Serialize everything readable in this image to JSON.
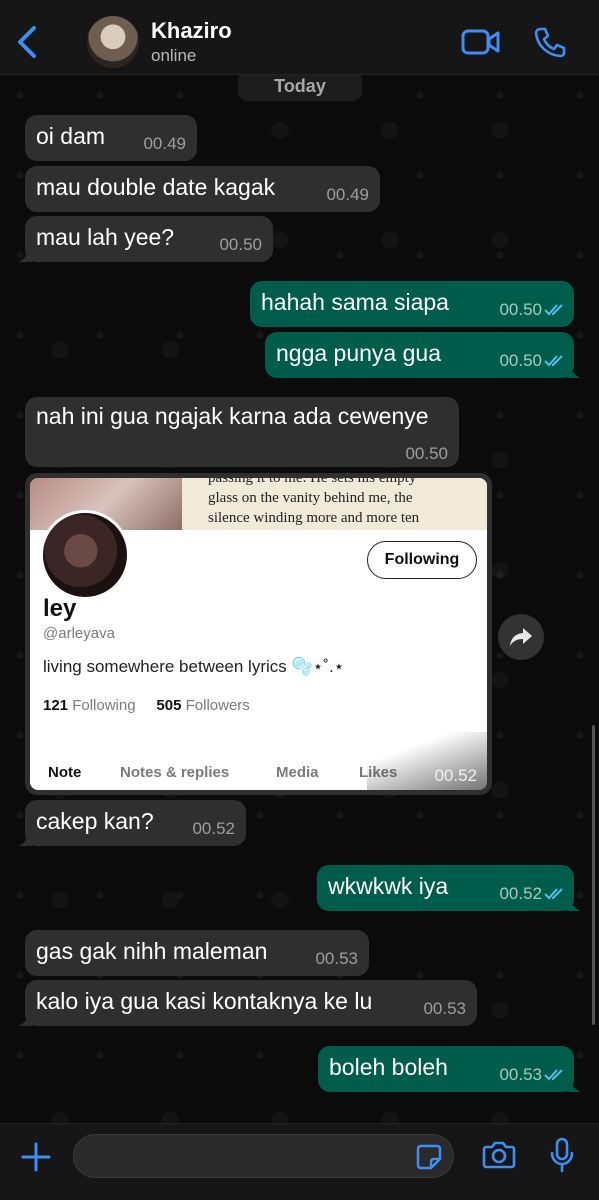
{
  "header": {
    "contact_name": "Khaziro",
    "status": "online"
  },
  "chat": {
    "day_label": "Today",
    "messages": [
      {
        "dir": "in",
        "text": "oi dam",
        "time": "00.49"
      },
      {
        "dir": "in",
        "text": "mau double date kagak",
        "time": "00.49"
      },
      {
        "dir": "in",
        "text": "mau lah yee?",
        "time": "00.50"
      },
      {
        "dir": "out",
        "text": "hahah sama siapa",
        "time": "00.50"
      },
      {
        "dir": "out",
        "text": "ngga punya gua",
        "time": "00.50"
      },
      {
        "dir": "in",
        "text": "nah ini gua ngajak karna ada cewenye",
        "time": "00.50"
      },
      {
        "dir": "in",
        "text": "cakep kan?",
        "time": "00.52"
      },
      {
        "dir": "out",
        "text": "wkwkwk iya",
        "time": "00.52"
      },
      {
        "dir": "in",
        "text": "gas gak nihh maleman",
        "time": "00.53"
      },
      {
        "dir": "in",
        "text": "kalo iya gua kasi kontaknya ke lu",
        "time": "00.53"
      },
      {
        "dir": "out",
        "text": "boleh boleh",
        "time": "00.53"
      }
    ],
    "image_message": {
      "time": "00.52",
      "banner_text": [
        "passing it to me. He sets his empty",
        "glass on the vanity behind me, the",
        "silence winding more and more ten"
      ],
      "profile": {
        "follow_label": "Following",
        "name": "ley",
        "handle": "@arleyava",
        "bio": "living somewhere between lyrics 🫧⋆˚.⋆",
        "following_count": "121",
        "following_label": "Following",
        "followers_count": "505",
        "followers_label": "Followers",
        "tabs": [
          "Note",
          "Notes & replies",
          "Media",
          "Likes"
        ]
      }
    }
  },
  "colors": {
    "incoming_bubble": "#2f2f2f",
    "outgoing_bubble": "#005c4b",
    "accent_blue": "#3d8ef5",
    "read_ticks": "#53bdeb"
  }
}
